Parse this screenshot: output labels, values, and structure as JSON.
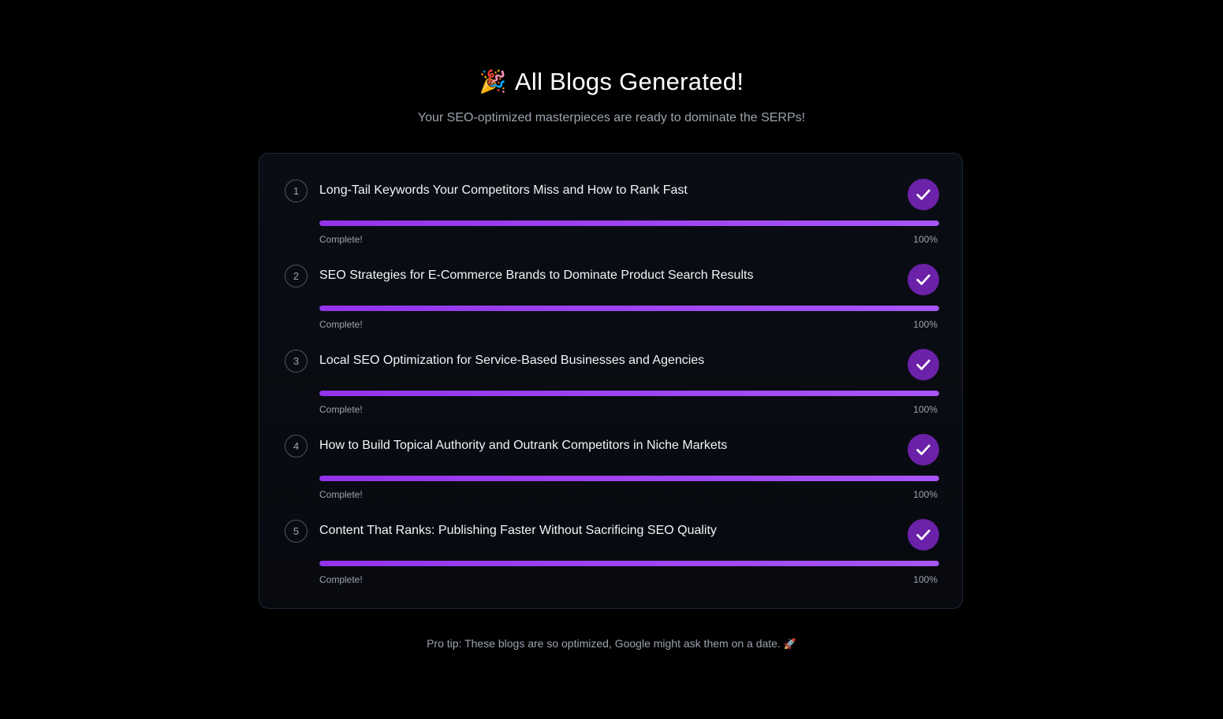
{
  "header": {
    "emoji": "🎉",
    "title": "All Blogs Generated!",
    "subtitle": "Your SEO-optimized masterpieces are ready to dominate the SERPs!"
  },
  "colors": {
    "accent": "#9333ea",
    "check_bg": "#6b21a8",
    "background": "#000000"
  },
  "blogs": [
    {
      "number": "1",
      "title": "Long-Tail Keywords Your Competitors Miss and How to Rank Fast",
      "status": "Complete!",
      "percent_label": "100%",
      "progress": 1.0
    },
    {
      "number": "2",
      "title": "SEO Strategies for E-Commerce Brands to Dominate Product Search Results",
      "status": "Complete!",
      "percent_label": "100%",
      "progress": 1.0
    },
    {
      "number": "3",
      "title": "Local SEO Optimization for Service-Based Businesses and Agencies",
      "status": "Complete!",
      "percent_label": "100%",
      "progress": 1.0
    },
    {
      "number": "4",
      "title": "How to Build Topical Authority and Outrank Competitors in Niche Markets",
      "status": "Complete!",
      "percent_label": "100%",
      "progress": 1.0
    },
    {
      "number": "5",
      "title": "Content That Ranks: Publishing Faster Without Sacrificing SEO Quality",
      "status": "Complete!",
      "percent_label": "100%",
      "progress": 1.0
    }
  ],
  "footer": {
    "tip": "Pro tip: These blogs are so optimized, Google might ask them on a date.",
    "emoji": "🚀"
  }
}
